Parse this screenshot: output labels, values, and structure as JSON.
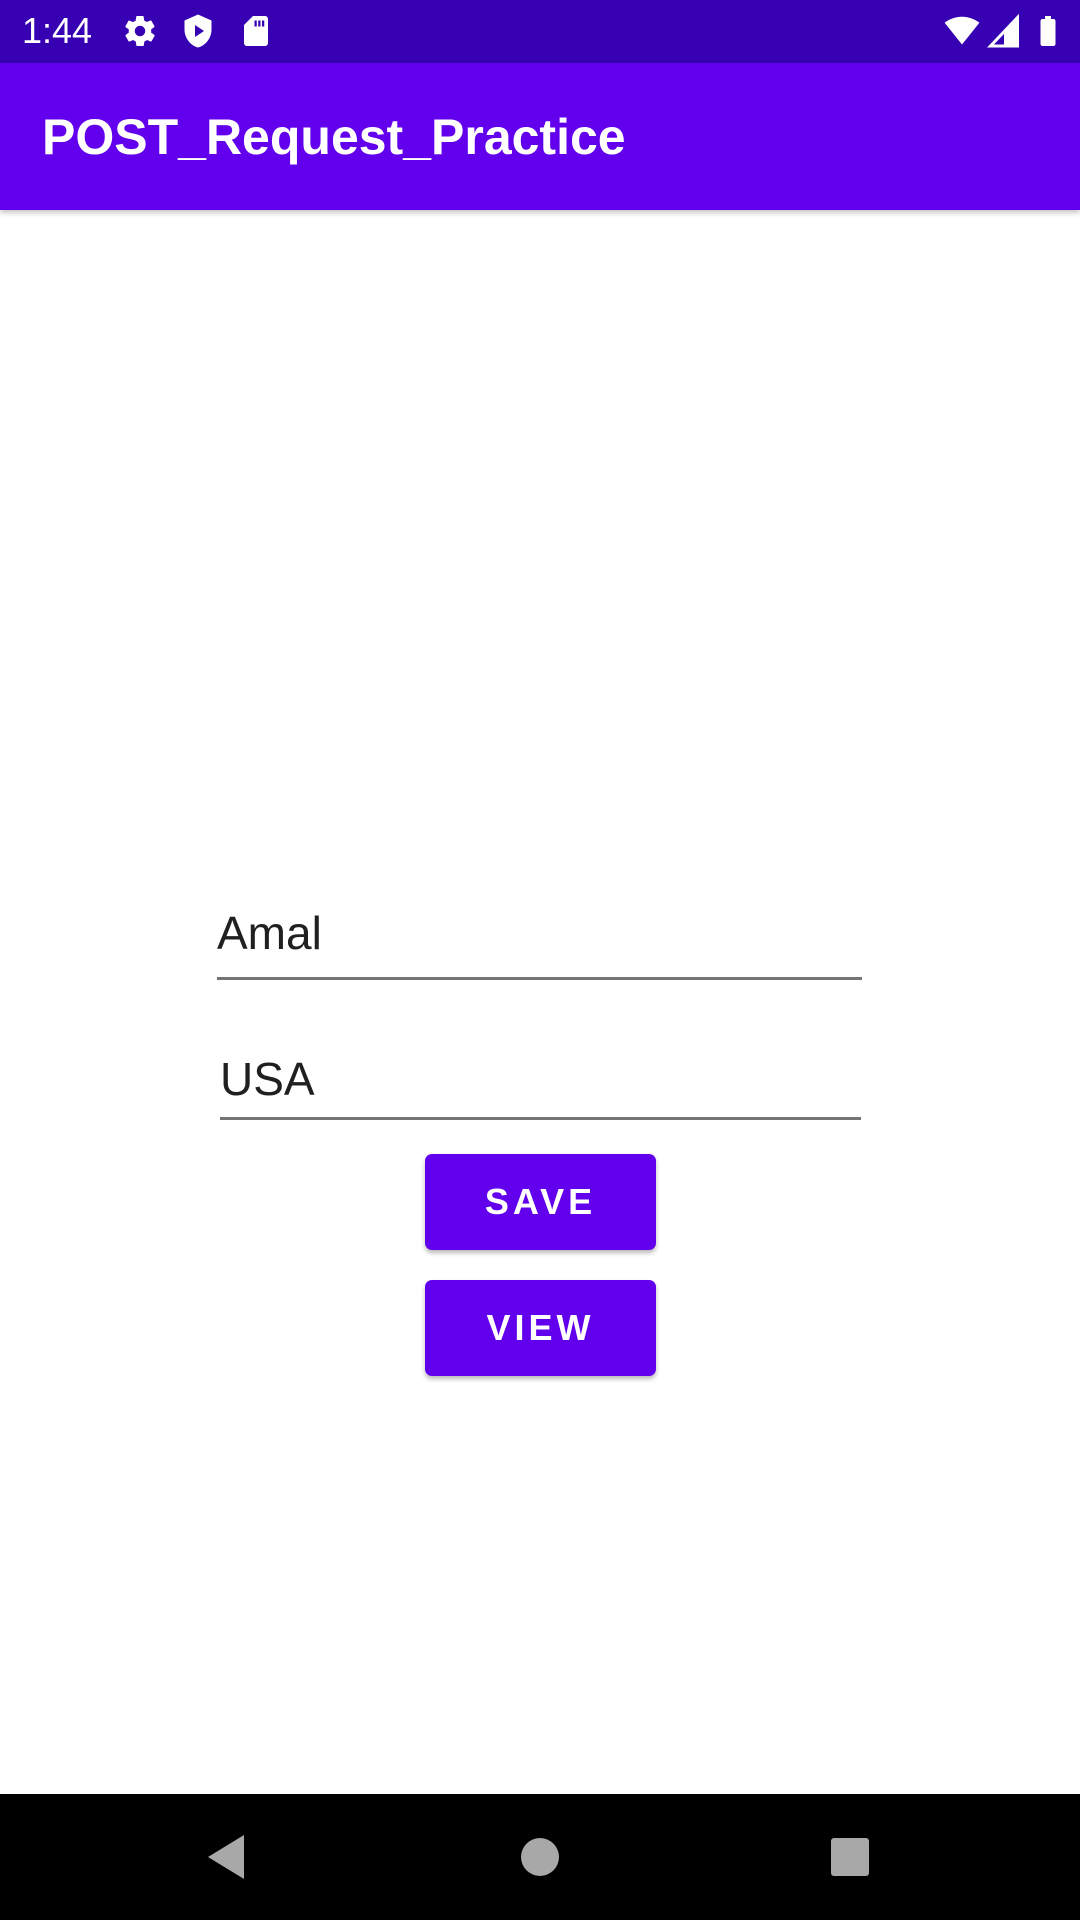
{
  "status_bar": {
    "time": "1:44",
    "icons": [
      "settings-gear-icon",
      "shield-play-icon",
      "sd-card-icon",
      "wifi-icon",
      "cell-signal-icon",
      "battery-icon"
    ]
  },
  "app_bar": {
    "title": "POST_Request_Practice",
    "color": "#6200EE"
  },
  "form": {
    "name_value": "Amal",
    "country_value": "USA"
  },
  "buttons": {
    "save_label": "SAVE",
    "view_label": "VIEW"
  },
  "nav_bar": {
    "icons": [
      "back-icon",
      "home-icon",
      "recents-icon"
    ]
  },
  "colors": {
    "status_bar": "#3700B3",
    "primary": "#6200EE",
    "background": "#FFFFFF"
  }
}
